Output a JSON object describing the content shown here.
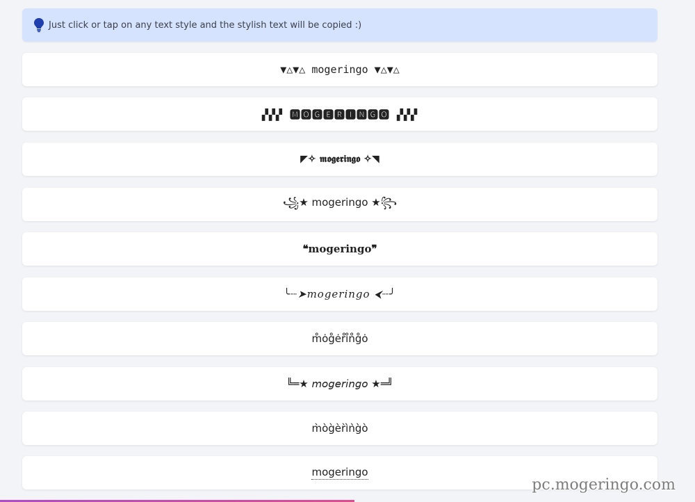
{
  "tip": {
    "icon": "lightbulb-icon",
    "text": "Just click or tap on any text style and the stylish text will be copied :)",
    "color": "#d6e3ff"
  },
  "styles": [
    "▼△▼△ mogeringo ▼△▼△",
    "▞▞▞ 🅼🅾🅶🅴🆁🅸🅽🅶🅾 ▞▞▞",
    "◤✧ 𝖒𝖔𝖌𝖊𝖗𝖎𝖓𝖌𝖔 ✧◥",
    "꧁★ mogeringo ★꧂",
    "❝𝐦𝐨𝐠𝐞𝐫𝐢𝐧𝐠𝐨❞",
    "╰┈➤𝑚𝑜𝑔𝑒𝑟𝑖𝑛𝑔𝑜 ⮜┈╯",
    "m̊ȯg̊ėr̊i̊n̊g̊ȯ",
    "╚═★ 𝘮𝘰𝘨𝘦𝘳𝘪𝘯𝘨𝘰 ★═╝",
    "m̀òg̀èr̀ìǹg̀ò",
    "mogeringo"
  ],
  "watermark": "pc.mogeringo.com"
}
